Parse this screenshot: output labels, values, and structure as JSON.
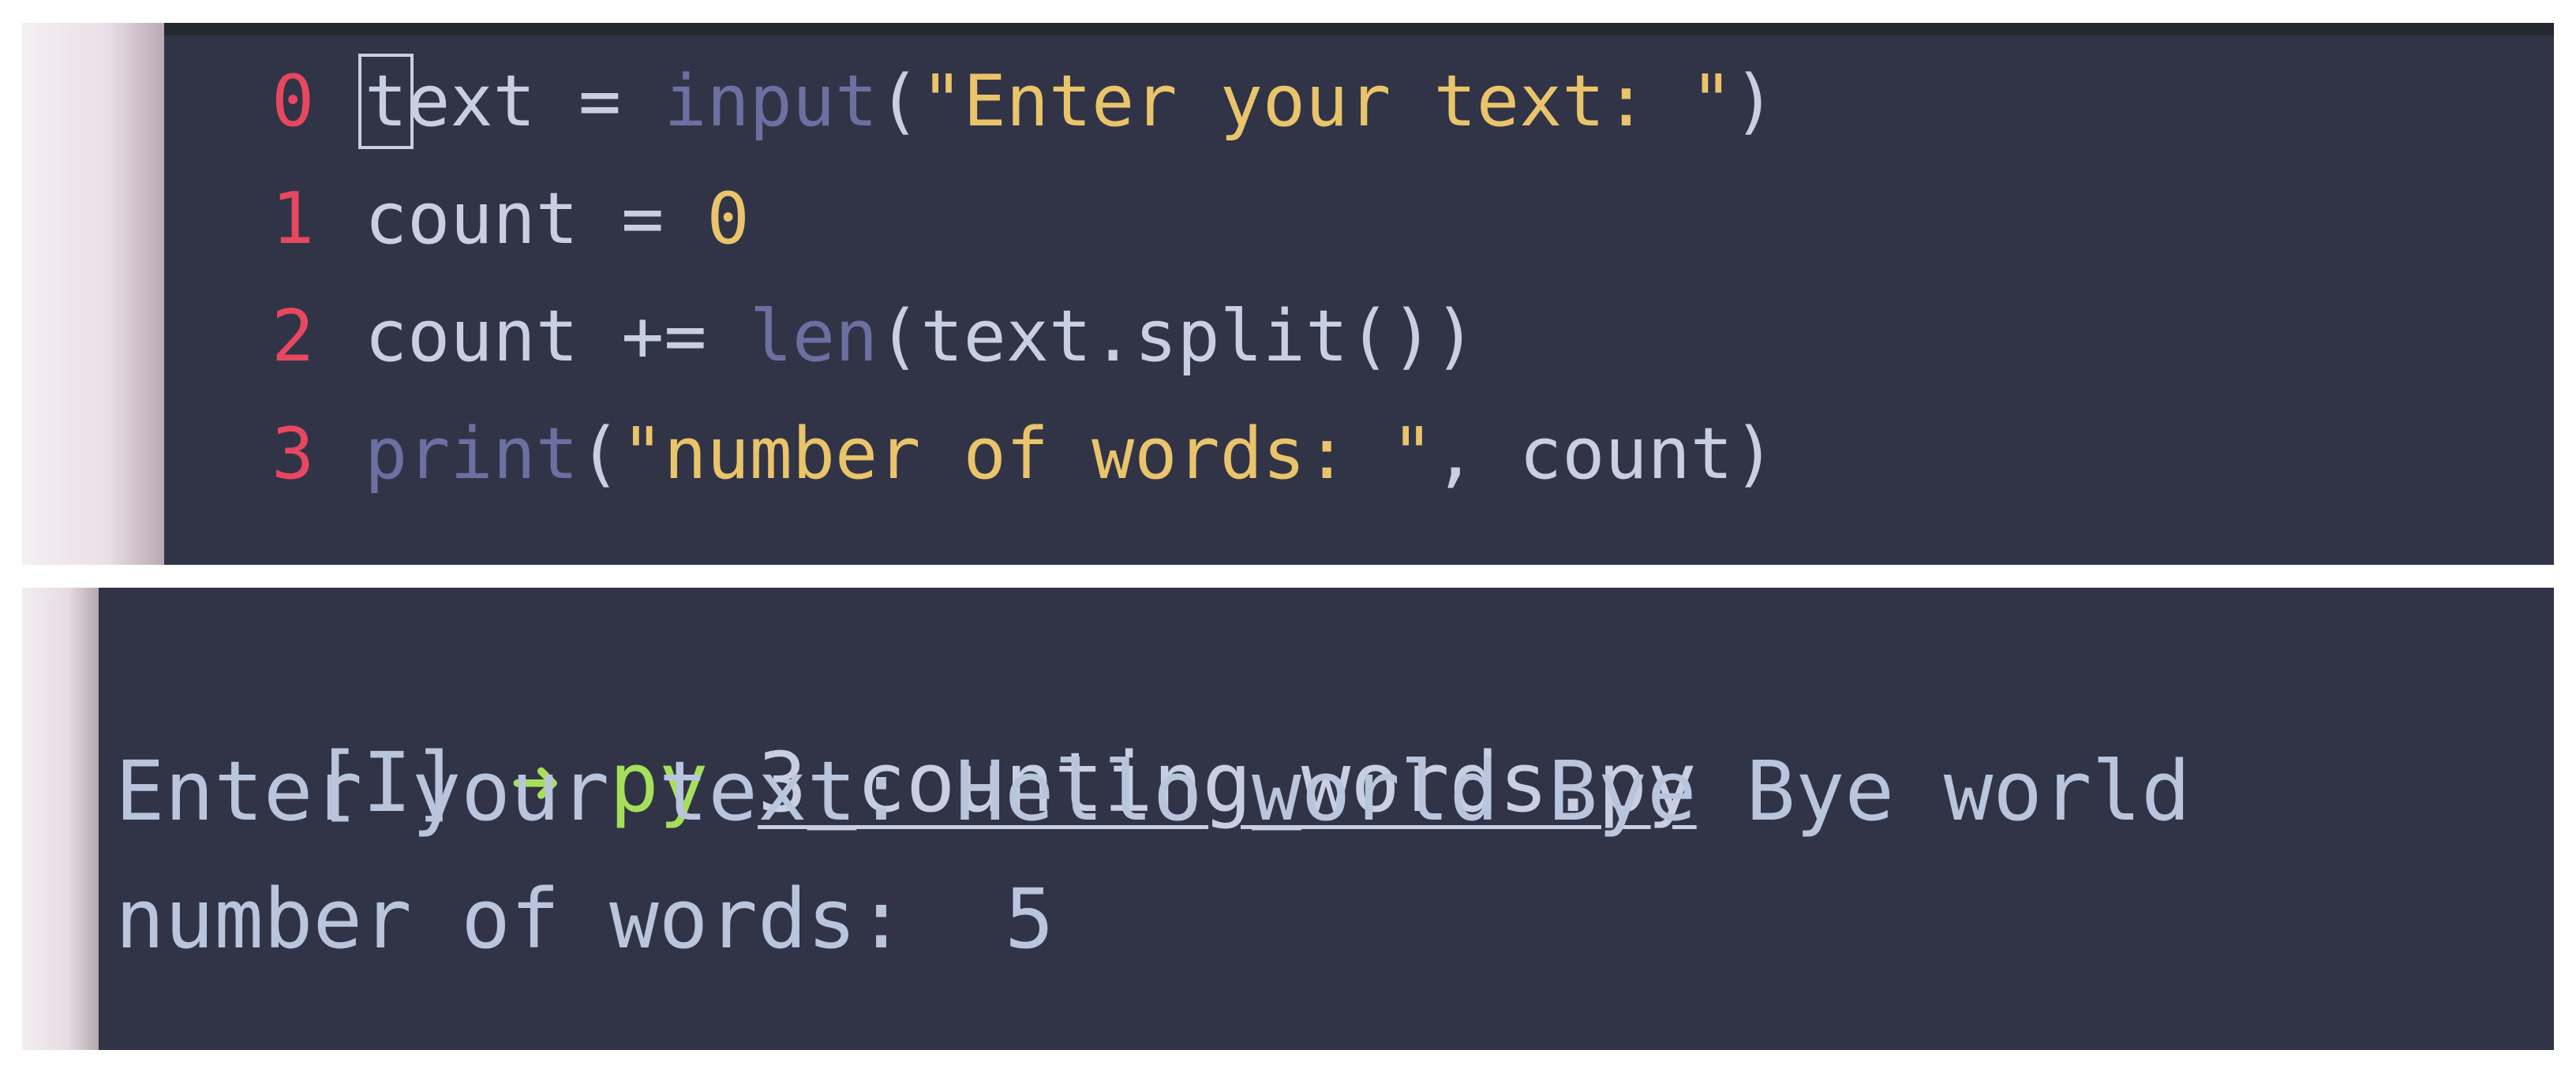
{
  "editor": {
    "lines": [
      {
        "number": "0",
        "tokens": [
          "text",
          " = ",
          "input",
          "(",
          "\"Enter your text: \"",
          ")"
        ]
      },
      {
        "number": "1",
        "tokens": [
          "count",
          " = ",
          "0"
        ]
      },
      {
        "number": "2",
        "tokens": [
          "count",
          " += ",
          "len",
          "(text.split())"
        ]
      },
      {
        "number": "3",
        "tokens": [
          "print",
          "(",
          "\"number of words: \"",
          ", count)"
        ]
      }
    ]
  },
  "terminal": {
    "prompt_mode": "[I]",
    "prompt_arrow": "➜",
    "command": "py",
    "argument": "3_counting_words.py",
    "output": [
      "Enter your text: Hello world Bye Bye world",
      "number of words:  5"
    ]
  },
  "colors": {
    "background": "#313447",
    "line_number": "#e8485f",
    "string": "#e9c46a",
    "builtin": "#6b70a0",
    "prompt_green": "#a6e05a"
  }
}
